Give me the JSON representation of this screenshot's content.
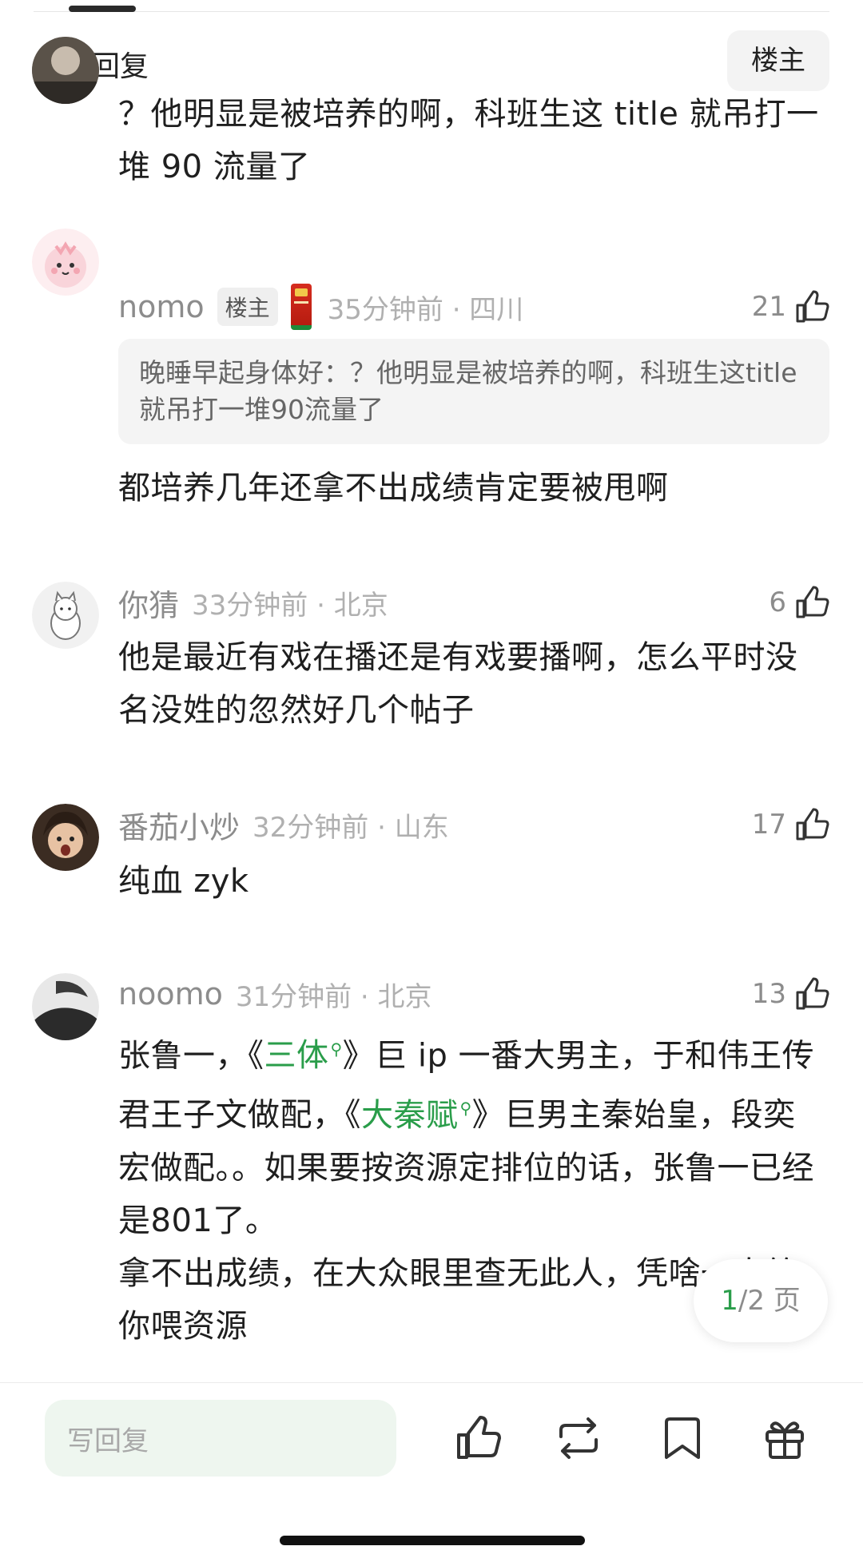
{
  "header": {
    "title": "全部回复",
    "op_filter_label": "楼主"
  },
  "comments": [
    {
      "text": "？他明显是被培养的啊，科班生这 title 就吊打一堆 90 流量了"
    },
    {
      "username": "nomo",
      "badge": "楼主",
      "time_location": "35分钟前 · 四川",
      "likes": "21",
      "quote": "晚睡早起身体好：？他明显是被培养的啊，科班生这title就吊打一堆90流量了",
      "text": "都培养几年还拿不出成绩肯定要被甩啊"
    },
    {
      "username": "你猜",
      "time_location": "33分钟前 · 北京",
      "likes": "6",
      "text": "他是最近有戏在播还是有戏要播啊，怎么平时没名没姓的忽然好几个帖子"
    },
    {
      "username": "番茄小炒",
      "time_location": "32分钟前 · 山东",
      "likes": "17",
      "text": "纯血 zyk"
    },
    {
      "username": "noomo",
      "time_location": "31分钟前 · 北京",
      "likes": "13",
      "segments": [
        "张鲁一，《",
        "三体",
        "》巨 ip 一番大男主，于和伟王传君王子文做配，《",
        "大秦赋",
        "》巨男主秦始皇，段奕宏做配。。如果要按资源定排位的话，张鲁一已经是801了。",
        "拿不出成绩，在大众眼里查无此人，凭啥一直给你喂资源"
      ]
    }
  ],
  "pager": {
    "current": "1",
    "total": "/2 页"
  },
  "bottom_bar": {
    "reply_placeholder": "写回复",
    "icons": [
      "thumbs-up-icon",
      "repost-icon",
      "bookmark-icon",
      "gift-icon"
    ]
  },
  "colors": {
    "accent_green": "#2a9d4a",
    "meta_gray": "#8c8c8c",
    "quote_bg": "#f4f4f4"
  }
}
